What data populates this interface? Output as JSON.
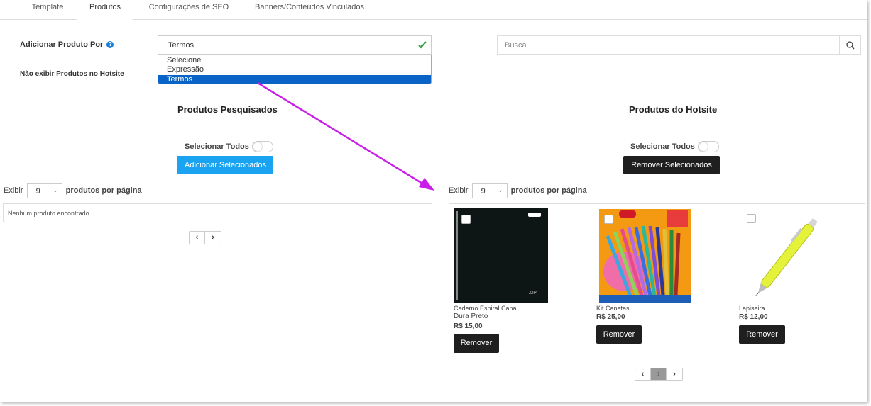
{
  "tabs": [
    "Template",
    "Produtos",
    "Configurações de SEO",
    "Banners/Conteúdos Vinculados"
  ],
  "form": {
    "add_by_label": "Adicionar Produto Por",
    "hide_label": "Não exibir Produtos no Hotsite",
    "selected_value": "Termos",
    "options": [
      "Selecione",
      "Expressão",
      "Termos"
    ],
    "search_placeholder": "Busca"
  },
  "left_panel": {
    "title": "Produtos Pesquisados",
    "select_all": "Selecionar Todos",
    "add_button": "Adicionar Selecionados",
    "exibir": "Exibir",
    "per_page": "9",
    "per_page_suffix": "produtos por página",
    "empty_message": "Nenhum produto encontrado"
  },
  "right_panel": {
    "title": "Produtos do Hotsite",
    "select_all": "Selecionar Todos",
    "remove_button": "Remover Selecionados",
    "exibir": "Exibir",
    "per_page": "9",
    "per_page_suffix": "produtos por página",
    "products": [
      {
        "name_line1": "Caderno Espiral Capa",
        "name_line2": "Dura Preto",
        "price": "R$ 15,00",
        "remove": "Remover"
      },
      {
        "name_line1": "Kit Canetas",
        "name_line2": "",
        "price": "R$ 25,00",
        "remove": "Remover"
      },
      {
        "name_line1": "Lapiseira",
        "name_line2": "",
        "price": "R$ 12,00",
        "remove": "Remover"
      }
    ],
    "current_page": "1"
  },
  "pager": {
    "prev": "‹",
    "next": "›"
  },
  "colors": {
    "accent_blue": "#1aa3f0",
    "selected_option": "#0a64c8",
    "dark_button": "#1f1f1f",
    "arrow": "#c81ee8"
  },
  "icons": [
    "check-icon",
    "help-icon",
    "search-icon",
    "chevron-down-icon",
    "chevron-left-icon",
    "chevron-right-icon"
  ]
}
